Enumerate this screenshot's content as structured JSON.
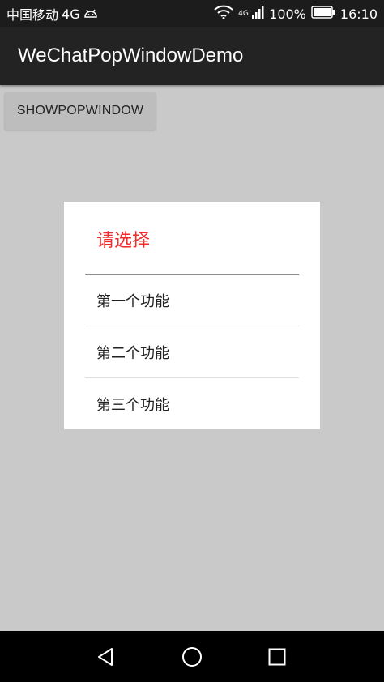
{
  "status_bar": {
    "carrier": "中国移动",
    "network": "4G",
    "mini_network_label": "4G",
    "battery_percent": "100%",
    "time": "16:10",
    "icons": [
      "android-debug-icon",
      "wifi-icon",
      "signal-icon",
      "battery-icon"
    ]
  },
  "app_bar": {
    "title": "WeChatPopWindowDemo"
  },
  "main": {
    "show_button_label": "SHOWPOPWINDOW"
  },
  "popup": {
    "title": "请选择",
    "title_color": "#ee2c2c",
    "items": [
      {
        "label": "第一个功能"
      },
      {
        "label": "第二个功能"
      },
      {
        "label": "第三个功能"
      }
    ]
  },
  "nav_bar": {
    "icons": [
      "back-icon",
      "home-icon",
      "recents-icon"
    ]
  },
  "colors": {
    "background": "#c9c9c9",
    "app_bar": "#232323",
    "status_bar": "#1c1c1c",
    "nav_bar": "#000000",
    "popup_bg": "#ffffff"
  }
}
